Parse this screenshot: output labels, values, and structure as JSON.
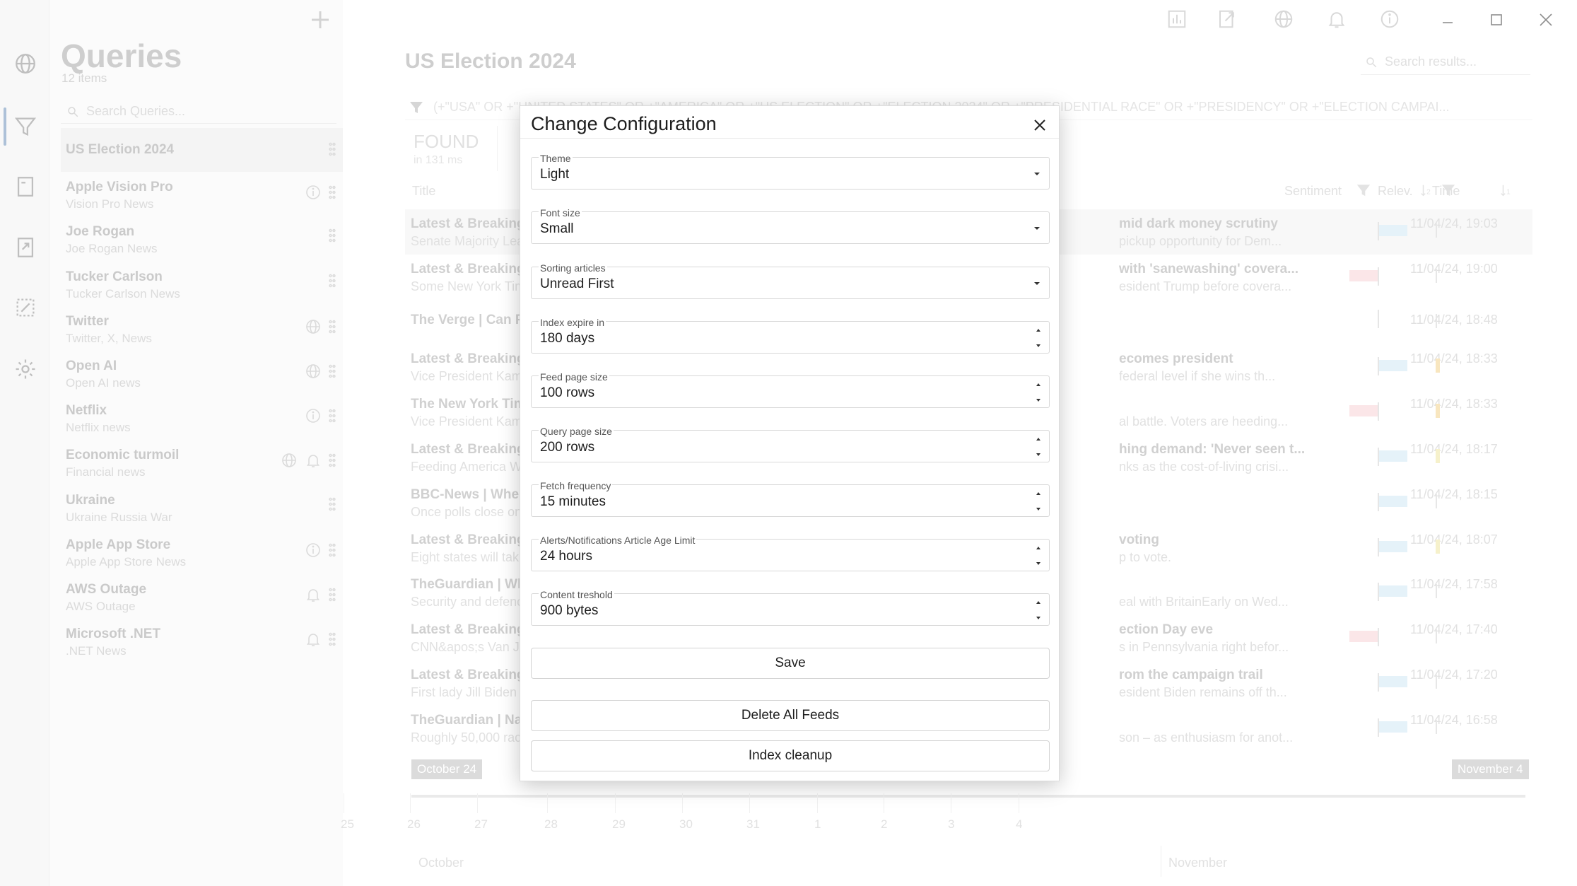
{
  "window": {
    "minimize_label": "",
    "maximize_label": "",
    "close_label": ""
  },
  "queries_panel": {
    "title": "Queries",
    "count": "12 items",
    "search_placeholder": "Search Queries...",
    "items": [
      {
        "title": "US Election 2024",
        "subtitle": "",
        "icons": []
      },
      {
        "title": "Apple Vision Pro",
        "subtitle": "Vision Pro News",
        "icons": [
          "info-icon"
        ]
      },
      {
        "title": "Joe Rogan",
        "subtitle": "Joe Rogan News",
        "icons": []
      },
      {
        "title": "Tucker Carlson",
        "subtitle": "Tucker Carlson News",
        "icons": []
      },
      {
        "title": "Twitter",
        "subtitle": "Twitter, X, News",
        "icons": [
          "globe-icon"
        ]
      },
      {
        "title": "Open AI",
        "subtitle": "Open AI news",
        "icons": [
          "globe-icon"
        ]
      },
      {
        "title": "Netflix",
        "subtitle": "Netflix news",
        "icons": [
          "info-icon"
        ]
      },
      {
        "title": "Economic turmoil",
        "subtitle": "Financial news",
        "icons": [
          "globe-icon",
          "bell-icon"
        ]
      },
      {
        "title": "Ukraine",
        "subtitle": "Ukraine Russia War",
        "icons": []
      },
      {
        "title": "Apple App Store",
        "subtitle": "Apple App Store News",
        "icons": [
          "info-icon"
        ]
      },
      {
        "title": "AWS Outage",
        "subtitle": "AWS Outage",
        "icons": [
          "bell-icon"
        ]
      },
      {
        "title": "Microsoft .NET",
        "subtitle": ".NET News",
        "icons": [
          "bell-icon"
        ]
      }
    ]
  },
  "main": {
    "title": "US Election 2024",
    "search_placeholder": "Search results...",
    "query_text": "(+\"USA\" OR +\"UNITED STATES\" OR +\"AMERICA\" OR +\"US ELECTION\" OR +\"ELECTION 2024\" OR +\"PRESIDENTIAL RACE\" OR +\"PRESIDENCY\" OR +\"ELECTION CAMPAI...",
    "found_label": "FOUND",
    "found_ms": "in 131 ms",
    "columns": {
      "title": "Title",
      "sentiment": "Sentiment",
      "relevance": "Relev.",
      "time": "Time"
    },
    "rows": [
      {
        "title": "Latest & Breaking",
        "sub": "Senate Majority Lea",
        "title_r": "mid dark money scrutiny",
        "sub_r": "pickup opportunity for Dem...",
        "time": "11/04/24, 19:03",
        "sent": "pos",
        "sent_w": 40,
        "rel": ""
      },
      {
        "title": "Latest & Breaking",
        "sub": "Some New York Tim",
        "title_r": "with 'sanewashing' covera...",
        "sub_r": "esident Trump before covera...",
        "time": "11/04/24, 19:00",
        "sent": "neg",
        "sent_w": 40,
        "rel": ""
      },
      {
        "title": "The Verge | Can Ph",
        "sub": "",
        "title_r": "",
        "sub_r": "",
        "time": "11/04/24, 18:48",
        "sent": "none",
        "sent_w": 0,
        "rel": ""
      },
      {
        "title": "Latest & Breaking",
        "sub": "Vice President Kam",
        "title_r": "ecomes president",
        "sub_r": "federal level if she wins th...",
        "time": "11/04/24, 18:33",
        "sent": "pos",
        "sent_w": 40,
        "rel": "orange"
      },
      {
        "title": "The New York Tim",
        "sub": "Vice President Kam",
        "title_r": "",
        "sub_r": "al battle. Voters are heeding...",
        "time": "11/04/24, 18:33",
        "sent": "neg",
        "sent_w": 40,
        "rel": "orange"
      },
      {
        "title": "Latest & Breaking",
        "sub": "Feeding America W",
        "title_r": "hing demand: 'Never seen t...",
        "sub_r": "nks as the cost-of-living crisi...",
        "time": "11/04/24, 18:17",
        "sent": "pos",
        "sent_w": 40,
        "rel": "yellow"
      },
      {
        "title": "BBC-News | When",
        "sub": "Once polls close on",
        "title_r": "",
        "sub_r": "",
        "time": "11/04/24, 18:15",
        "sent": "pos",
        "sent_w": 40,
        "rel": ""
      },
      {
        "title": "Latest & Breaking",
        "sub": "Eight states will tak",
        "title_r": "voting",
        "sub_r": "p to vote.",
        "time": "11/04/24, 18:07",
        "sent": "pos",
        "sent_w": 40,
        "rel": "yellow"
      },
      {
        "title": "TheGuardian | Wh",
        "sub": "Security and defenc",
        "title_r": "",
        "sub_r": "eal with BritainEarly on Wed...",
        "time": "11/04/24, 17:58",
        "sent": "pos",
        "sent_w": 40,
        "rel": ""
      },
      {
        "title": "Latest & Breaking",
        "sub": "CNN&apos;s Van Jo",
        "title_r": "ection Day eve",
        "sub_r": "s in Pennsylvania right befor...",
        "time": "11/04/24, 17:40",
        "sent": "neg",
        "sent_w": 40,
        "rel": ""
      },
      {
        "title": "Latest & Breaking",
        "sub": "First lady Jill Biden",
        "title_r": "rom the campaign trail",
        "sub_r": "esident Biden remains off th...",
        "time": "11/04/24, 17:20",
        "sent": "pos",
        "sent_w": 40,
        "rel": ""
      },
      {
        "title": "TheGuardian | Nas",
        "sub": "Roughly 50,000 rac",
        "title_r": "",
        "sub_r": "son – as enthusiasm for anot...",
        "time": "11/04/24, 16:58",
        "sent": "pos",
        "sent_w": 40,
        "rel": ""
      }
    ],
    "timeline": {
      "start_tag": "October 24",
      "end_tag": "November 4",
      "days": [
        "25",
        "26",
        "27",
        "28",
        "29",
        "30",
        "31",
        "1",
        "2",
        "3",
        "4"
      ],
      "months": [
        "October",
        "November"
      ]
    }
  },
  "dialog": {
    "title": "Change Configuration",
    "fields": {
      "theme": {
        "label": "Theme",
        "value": "Light"
      },
      "font_size": {
        "label": "Font size",
        "value": "Small"
      },
      "sorting": {
        "label": "Sorting articles",
        "value": "Unread First"
      },
      "index_expire": {
        "label": "Index expire in",
        "value": "180 days"
      },
      "feed_page": {
        "label": "Feed page size",
        "value": "100 rows"
      },
      "query_page": {
        "label": "Query page size",
        "value": "200 rows"
      },
      "fetch_freq": {
        "label": "Fetch frequency",
        "value": "15 minutes"
      },
      "alert_age": {
        "label": "Alerts/Notifications Article Age Limit",
        "value": "24 hours"
      },
      "content_threshold": {
        "label": "Content treshold",
        "value": "900 bytes"
      }
    },
    "buttons": {
      "save": "Save",
      "delete_all": "Delete All Feeds",
      "index_cleanup": "Index cleanup"
    }
  },
  "colors": {
    "sentiment_positive": "#cfe8f5",
    "sentiment_negative": "#f7d1d5",
    "relevance_orange": "#f3d28a",
    "relevance_yellow": "#efe6a0",
    "rail_active": "#6a8fb8"
  }
}
